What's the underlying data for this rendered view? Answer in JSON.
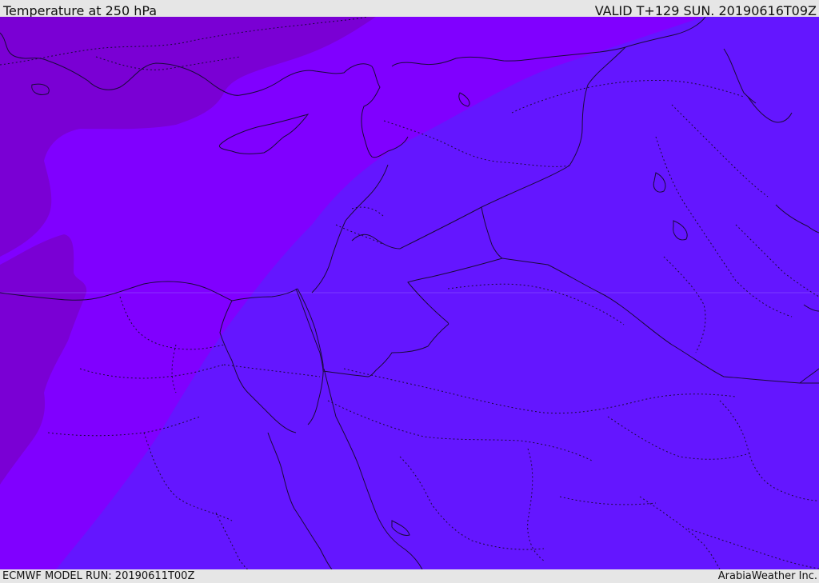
{
  "header": {
    "title": "Temperature at 250 hPa",
    "valid": "VALID T+129 SUN. 20190616T09Z"
  },
  "footer": {
    "model_run": "ECMWF MODEL RUN: 20190611T00Z",
    "credit": "ArabiaWeather Inc."
  },
  "colors": {
    "zone_cold": "#7a00d4",
    "zone_mid": "#8000ff",
    "zone_warm": "#6416ff",
    "borders": "#1a0a3a"
  }
}
